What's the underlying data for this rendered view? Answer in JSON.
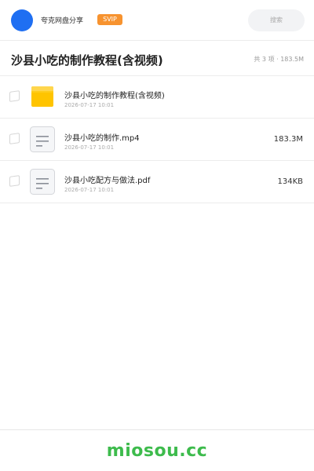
{
  "header": {
    "user_name": "夸克网盘分享",
    "badge": "SVIP",
    "search_placeholder": "搜索",
    "avatar_color": "#1f6ff2",
    "badge_color": "#f7932f"
  },
  "folder": {
    "title": "沙县小吃的制作教程(含视频)",
    "summary": "共 3 项 · 183.5M"
  },
  "files": [
    {
      "icon": "folder-icon",
      "name": "沙县小吃的制作教程(含视频)",
      "date": "2026-07-17 10:01",
      "size": ""
    },
    {
      "icon": "document-icon",
      "name": "沙县小吃的制作.mp4",
      "date": "2026-07-17 10:01",
      "size": "183.3M"
    },
    {
      "icon": "document-icon",
      "name": "沙县小吃配方与做法.pdf",
      "date": "2026-07-17 10:01",
      "size": "134KB"
    }
  ],
  "footer": {
    "brand": "miosou.cc",
    "brand_color": "#3dbb4c"
  }
}
